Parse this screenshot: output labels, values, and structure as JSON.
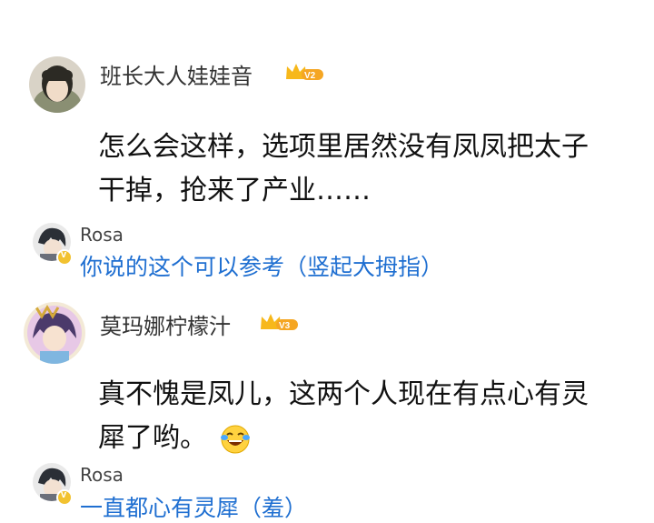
{
  "comments": [
    {
      "username": "班长大人娃娃音",
      "level_badge": "V2",
      "text_lines": [
        "怎么会这样，选项里居然没有凤凤把太子",
        "干掉，抢来了产业……"
      ],
      "reply": {
        "username": "Rosa",
        "verified_badge": "v",
        "text": "你说的这个可以参考（竖起大拇指）"
      }
    },
    {
      "username": "莫玛娜柠檬汁",
      "level_badge": "V3",
      "text_lines": [
        "真不愧是凤儿，这两个人现在有点心有灵",
        "犀了哟。"
      ],
      "emoji": "laughing-tears-emoji",
      "reply": {
        "username": "Rosa",
        "verified_badge": "v",
        "text": "一直都心有灵犀（羞）"
      }
    }
  ],
  "colors": {
    "reply_text": "#1f6fd1",
    "crown": "#f7b81b",
    "vip_bg": "#f5a623",
    "verified": "#f2c230"
  }
}
